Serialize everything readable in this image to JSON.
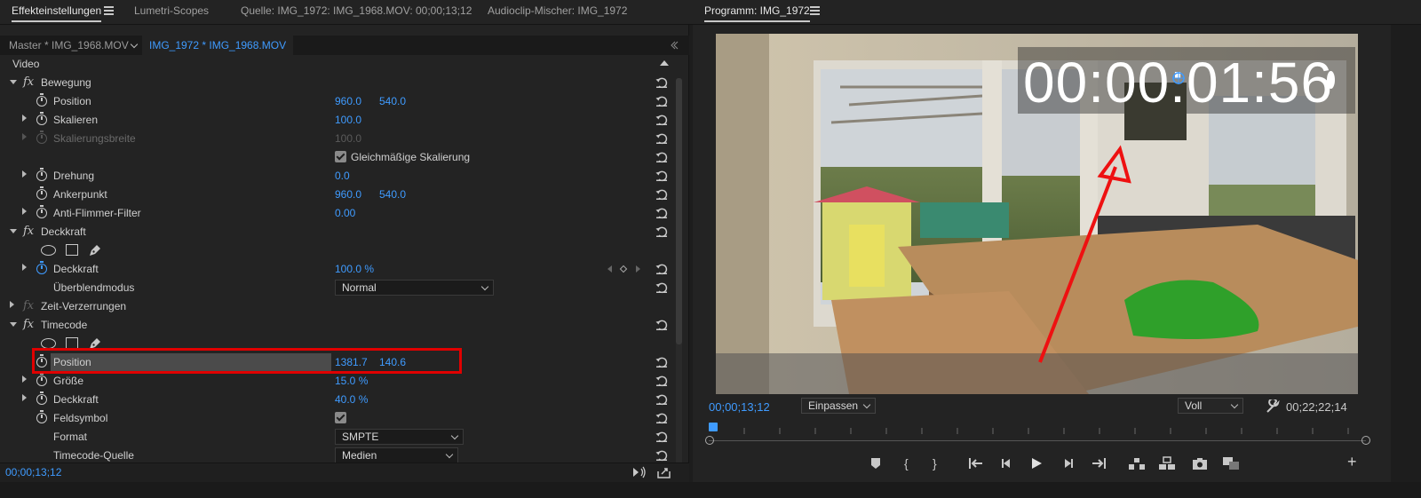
{
  "tabs": {
    "effects": "Effekteinstellungen",
    "lumetri": "Lumetri-Scopes",
    "source": "Quelle: IMG_1972: IMG_1968.MOV: 00;00;13;12",
    "audio": "Audioclip-Mischer: IMG_1972",
    "program": "Programm: IMG_1972"
  },
  "clipbar": {
    "master": "Master * IMG_1968.MOV",
    "sequence": "IMG_1972 * IMG_1968.MOV"
  },
  "effects": {
    "video_header": "Video",
    "bewegung": {
      "title": "Bewegung",
      "position_label": "Position",
      "position_x": "960.0",
      "position_y": "540.0",
      "skalieren_label": "Skalieren",
      "skalieren_value": "100.0",
      "skalbreite_label": "Skalierungsbreite",
      "skalbreite_value": "100.0",
      "uniform_label": "Gleichmäßige Skalierung",
      "drehung_label": "Drehung",
      "drehung_value": "0.0",
      "anker_label": "Ankerpunkt",
      "anker_x": "960.0",
      "anker_y": "540.0",
      "flimmer_label": "Anti-Flimmer-Filter",
      "flimmer_value": "0.00"
    },
    "deckkraft": {
      "title": "Deckkraft",
      "deckkraft_label": "Deckkraft",
      "deckkraft_value": "100.0 %",
      "blend_label": "Überblendmodus",
      "blend_value": "Normal"
    },
    "zeit": {
      "title": "Zeit-Verzerrungen"
    },
    "timecode": {
      "title": "Timecode",
      "position_label": "Position",
      "position_x": "1381.7",
      "position_y": "140.6",
      "groesse_label": "Größe",
      "groesse_value": "15.0 %",
      "deckkraft_label": "Deckkraft",
      "deckkraft_value": "40.0 %",
      "feldsymbol_label": "Feldsymbol",
      "format_label": "Format",
      "format_value": "SMPTE",
      "quelle_label": "Timecode-Quelle",
      "quelle_value": "Medien"
    },
    "current_time": "00;00;13;12"
  },
  "program": {
    "overlay_timecode": "00:00:01:56",
    "current_time": "00;00;13;12",
    "fit_value": "Einpassen",
    "quality_value": "Voll",
    "duration": "00;22;22;14",
    "playhead_fraction": 0
  },
  "colors": {
    "accent": "#3f9bff",
    "highlight": "#e00000",
    "arrow": "#ee1111"
  }
}
